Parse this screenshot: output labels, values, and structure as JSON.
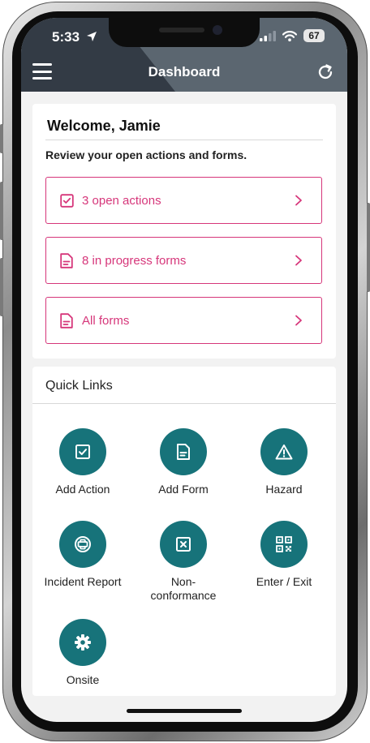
{
  "status_bar": {
    "time": "5:33",
    "battery": "67"
  },
  "header": {
    "title": "Dashboard"
  },
  "welcome": {
    "title": "Welcome, Jamie",
    "subtitle": "Review your open actions and forms.",
    "items": [
      {
        "label": "3 open actions",
        "icon": "checkbox-icon"
      },
      {
        "label": "8 in progress forms",
        "icon": "document-icon"
      },
      {
        "label": "All forms",
        "icon": "document-icon"
      }
    ]
  },
  "quick_links": {
    "title": "Quick Links",
    "items": [
      {
        "label": "Add Action",
        "icon": "checkbox-icon"
      },
      {
        "label": "Add Form",
        "icon": "document-icon"
      },
      {
        "label": "Hazard",
        "icon": "warning-icon"
      },
      {
        "label": "Incident Report",
        "icon": "plus-circle-icon"
      },
      {
        "label": "Non-\nconformance",
        "icon": "x-box-icon"
      },
      {
        "label": "Enter / Exit",
        "icon": "qr-code-icon"
      },
      {
        "label": "Onsite",
        "icon": "gear-icon"
      }
    ]
  },
  "colors": {
    "accent": "#d6367a",
    "teal": "#17737a",
    "header": "#5b6670"
  }
}
